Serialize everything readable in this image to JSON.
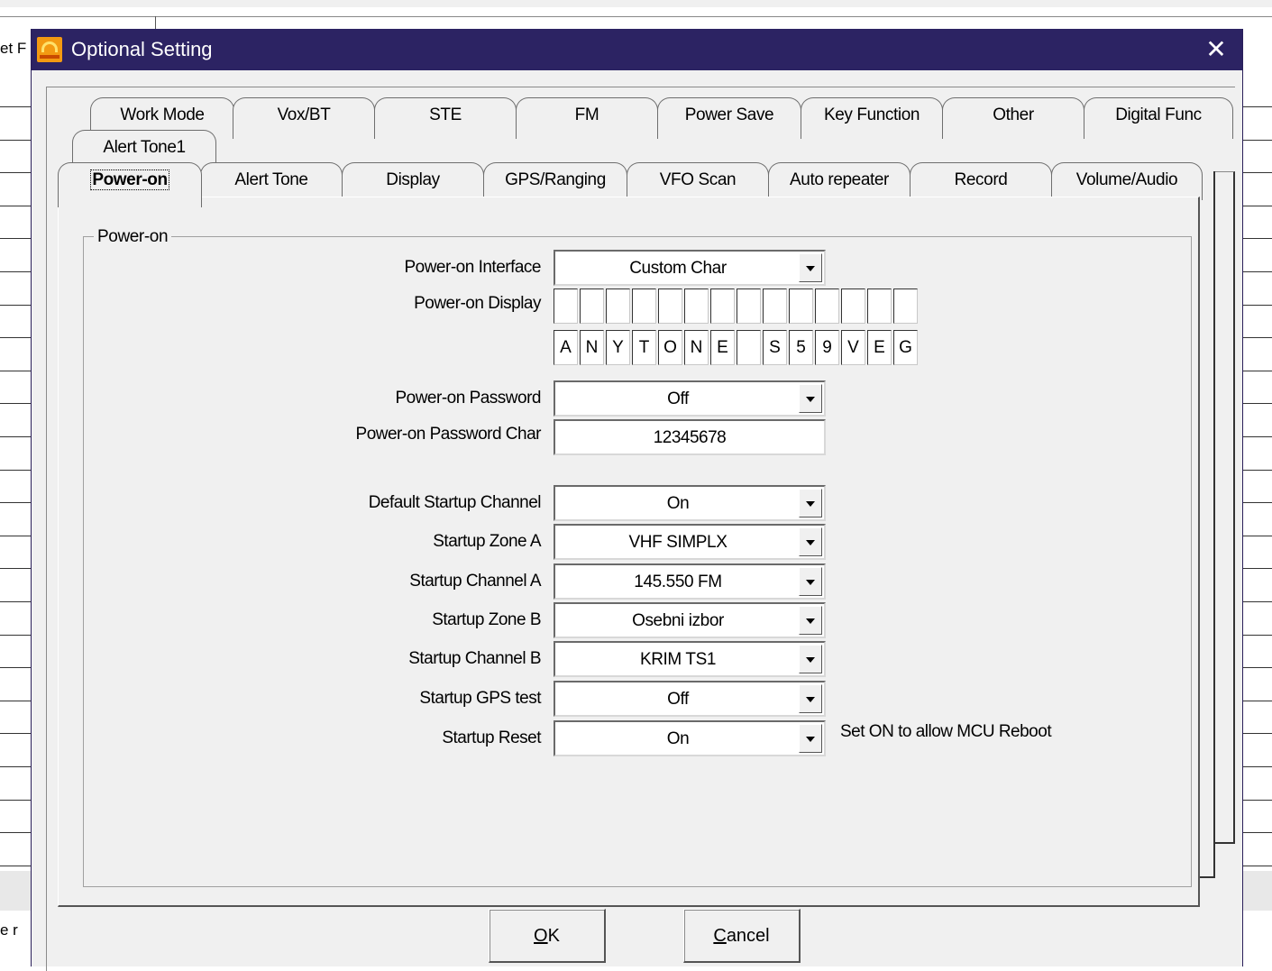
{
  "background": {
    "fragment_top": "et F",
    "fragment_bottom": "e r"
  },
  "dialog": {
    "title": "Optional Setting",
    "close_symbol": "✕"
  },
  "tabs": {
    "row1": [
      "Work Mode",
      "Vox/BT",
      "STE",
      "FM",
      "Power Save",
      "Key Function",
      "Other",
      "Digital Func"
    ],
    "row2": [
      "Alert Tone1"
    ],
    "row3": [
      "Power-on",
      "Alert Tone",
      "Display",
      "GPS/Ranging",
      "VFO Scan",
      "Auto repeater",
      "Record",
      "Volume/Audio"
    ],
    "active": "Power-on"
  },
  "group": {
    "label": "Power-on"
  },
  "fields": {
    "power_on_interface": {
      "label": "Power-on Interface",
      "value": "Custom Char"
    },
    "power_on_display": {
      "label": "Power-on Display",
      "line1": [
        "",
        "",
        "",
        "",
        "",
        "",
        "",
        "",
        "",
        "",
        "",
        "",
        "",
        ""
      ],
      "line2": [
        "A",
        "N",
        "Y",
        "T",
        "O",
        "N",
        "E",
        "",
        "S",
        "5",
        "9",
        "V",
        "E",
        "G"
      ]
    },
    "power_on_password": {
      "label": "Power-on Password",
      "value": "Off"
    },
    "power_on_password_char": {
      "label": "Power-on Password Char",
      "value": "12345678"
    },
    "default_startup_channel": {
      "label": "Default Startup Channel",
      "value": "On"
    },
    "startup_zone_a": {
      "label": "Startup Zone A",
      "value": "VHF SIMPLX"
    },
    "startup_channel_a": {
      "label": "Startup Channel A",
      "value": "145.550 FM"
    },
    "startup_zone_b": {
      "label": "Startup Zone B",
      "value": "Osebni izbor"
    },
    "startup_channel_b": {
      "label": "Startup Channel B",
      "value": "KRIM TS1"
    },
    "startup_gps_test": {
      "label": "Startup GPS test",
      "value": "Off"
    },
    "startup_reset": {
      "label": "Startup Reset",
      "value": "On",
      "note": "Set ON to allow MCU Reboot"
    }
  },
  "buttons": {
    "ok": {
      "mnemonic": "O",
      "rest": "K"
    },
    "cancel": {
      "mnemonic": "C",
      "rest": "ancel"
    }
  },
  "colors": {
    "titlebar": "#2c2363",
    "dialog_bg": "#f0f0f0",
    "icon": "#f39a12"
  }
}
